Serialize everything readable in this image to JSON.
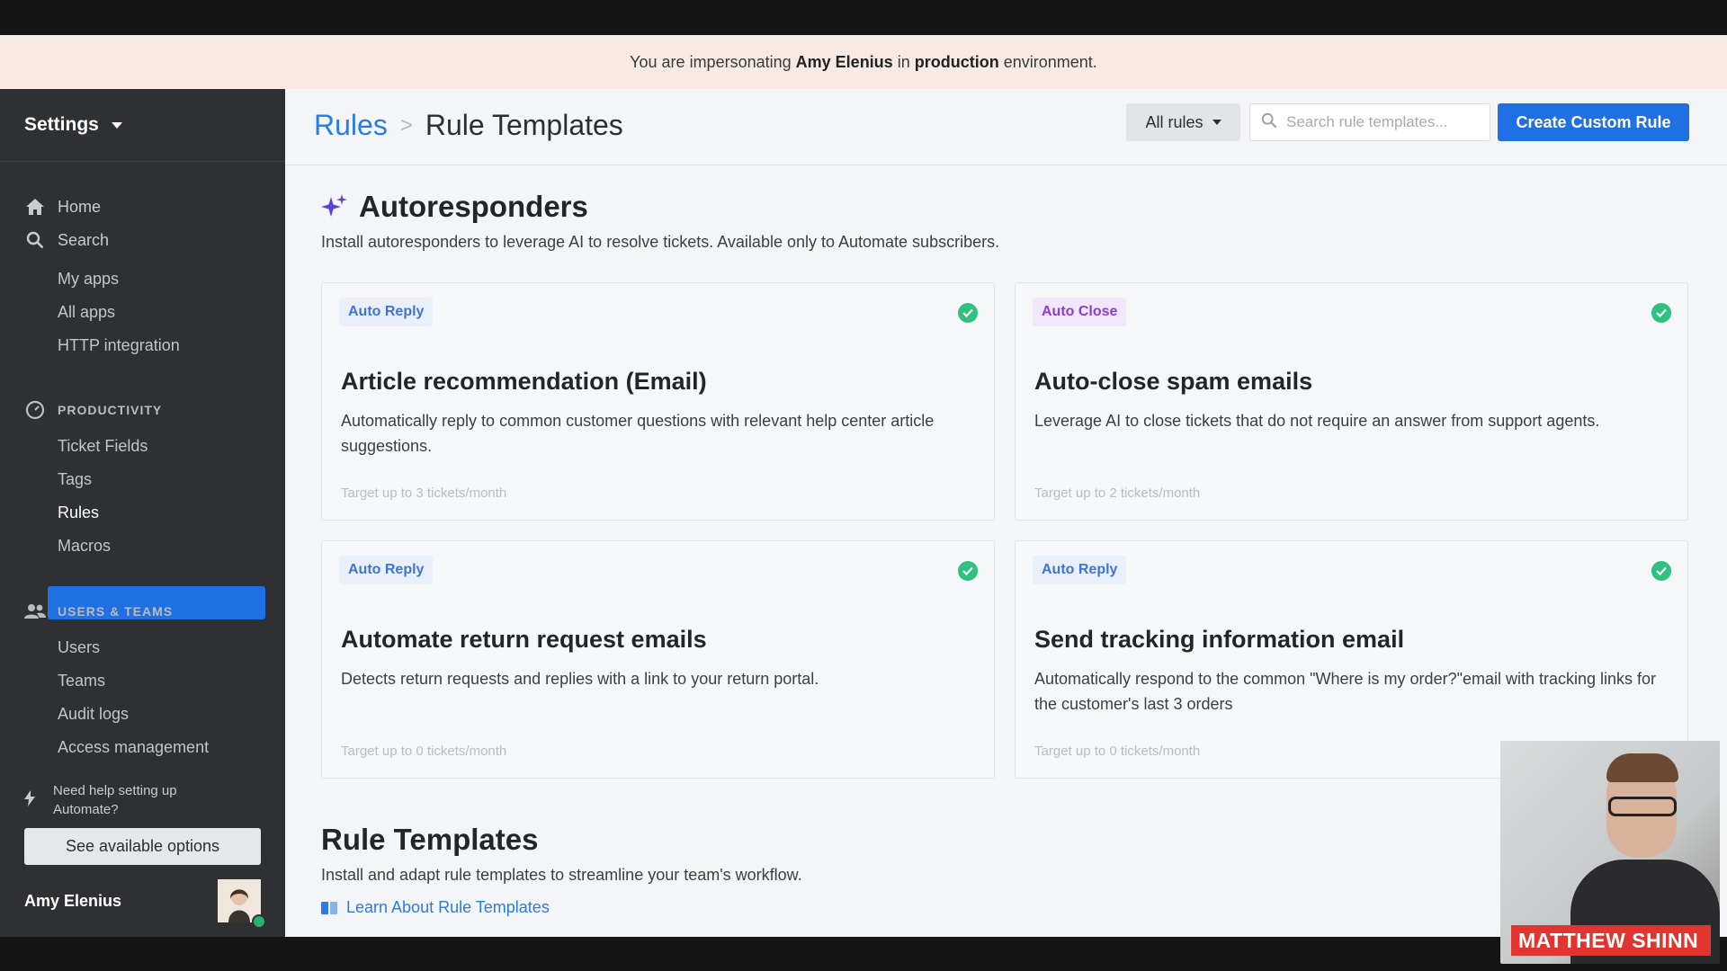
{
  "banner": {
    "prefix": "You are impersonating",
    "user": "Amy Elenius",
    "middle": "in",
    "env": "production",
    "suffix": "environment."
  },
  "sidebar": {
    "title": "Settings",
    "top_items": [
      {
        "label": "Home",
        "icon": "home-icon"
      },
      {
        "label": "Search",
        "icon": "search-icon"
      }
    ],
    "app_items": [
      "My apps",
      "All apps",
      "HTTP integration"
    ],
    "productivity": {
      "label": "PRODUCTIVITY",
      "icon": "gauge-icon",
      "items": [
        "Ticket Fields",
        "Tags",
        "Rules",
        "Macros"
      ],
      "active": "Rules"
    },
    "users_teams": {
      "label": "USERS & TEAMS",
      "icon": "users-icon",
      "items": [
        "Users",
        "Teams",
        "Audit logs",
        "Access management"
      ]
    },
    "help_text_1": "Need help setting up",
    "help_text_2": "Automate?",
    "help_button": "See available options",
    "user_name": "Amy Elenius"
  },
  "header": {
    "breadcrumb_parent": "Rules",
    "breadcrumb_sep": ">",
    "breadcrumb_current": "Rule Templates",
    "filter_label": "All rules",
    "search_placeholder": "Search rule templates...",
    "create_button": "Create Custom Rule"
  },
  "autoresponders": {
    "title": "Autoresponders",
    "description": "Install autoresponders to leverage AI to resolve tickets. Available only to Automate subscribers.",
    "cards": [
      {
        "tag": "Auto Reply",
        "tag_color": "#3f74d6",
        "title": "Article recommendation (Email)",
        "description": "Automatically reply to common customer questions with relevant help center article suggestions.",
        "footer": "Target up to 3 tickets/month",
        "installed": true
      },
      {
        "tag": "Auto Close",
        "tag_color": "#8a3fc9",
        "title": "Auto-close spam emails",
        "description": "Leverage AI to close tickets that do not require an answer from support agents.",
        "footer": "Target up to 2 tickets/month",
        "installed": true
      },
      {
        "tag": "Auto Reply",
        "tag_color": "#3f74d6",
        "title": "Automate return request emails",
        "description": "Detects return requests and replies with a link to your return portal.",
        "footer": "Target up to 0 tickets/month",
        "installed": true
      },
      {
        "tag": "Auto Reply",
        "tag_color": "#3f74d6",
        "title": "Send tracking information email",
        "description": "Automatically respond to the common \"Where is my order?\"email with tracking links for the customer's last 3 orders",
        "footer": "Target up to 0 tickets/month",
        "installed": true
      }
    ]
  },
  "rule_templates": {
    "title": "Rule Templates",
    "description": "Install and adapt rule templates to streamline your team's workflow.",
    "link": "Learn About Rule Templates"
  },
  "webcam": {
    "name_label": "MATTHEW SHINN"
  },
  "colors": {
    "accent": "#1f6fe5",
    "sidebar_bg": "#2e3033",
    "banner_bg": "#f7eae4",
    "success": "#2ec27e"
  }
}
